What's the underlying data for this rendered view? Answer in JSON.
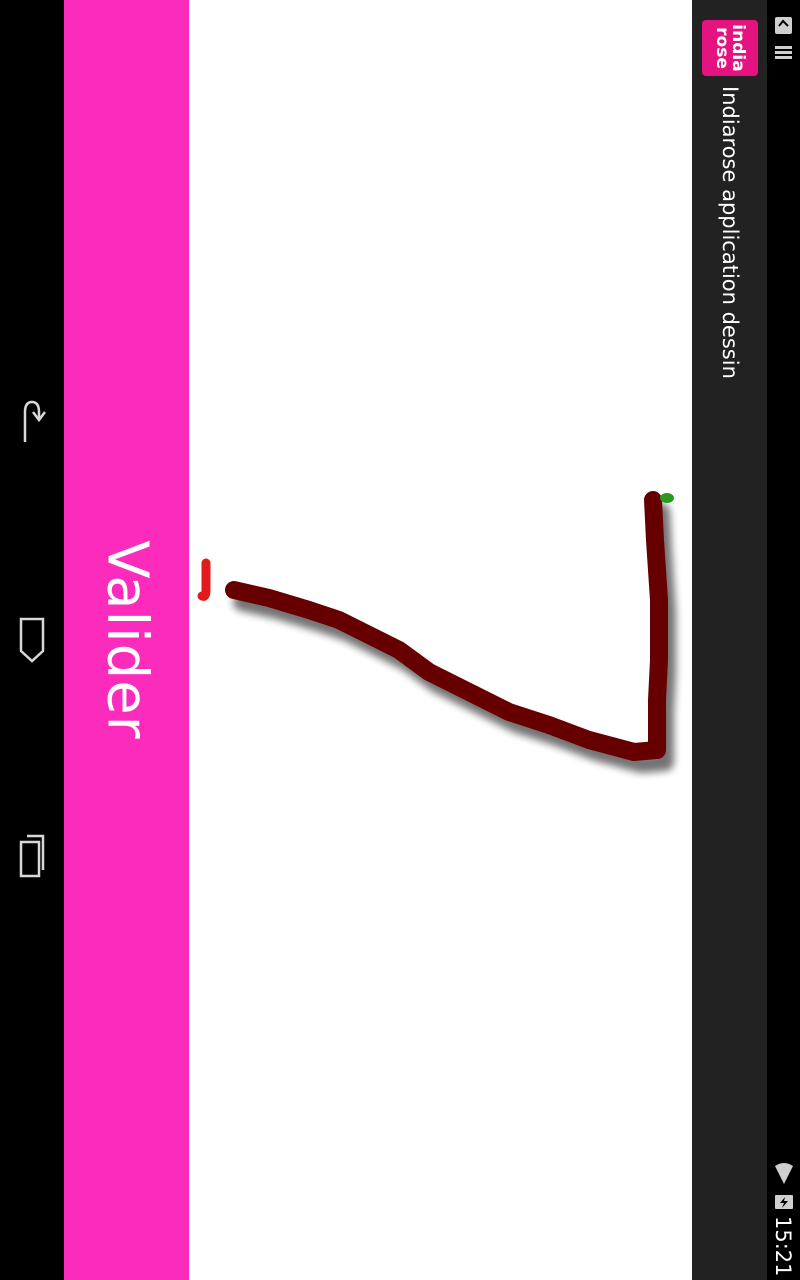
{
  "app": {
    "title": "Indiarose application dessin",
    "logo_text": "india\nrose"
  },
  "actions": {
    "validate_label": "Valider"
  },
  "status_bar": {
    "time": "15:21",
    "icons": [
      "wifi-icon",
      "battery-charging-icon",
      "notification-icon",
      "storage-icon"
    ]
  },
  "nav_bar": {
    "icons": [
      "back-icon",
      "home-icon",
      "recent-apps-icon"
    ]
  },
  "colors": {
    "validate_bg": "#fb2bbc",
    "stroke": "#660000",
    "start_marker": "#e11b1b",
    "end_marker": "#2a9a1e",
    "action_bar": "#222222",
    "logo_bg": "#e5137f"
  }
}
